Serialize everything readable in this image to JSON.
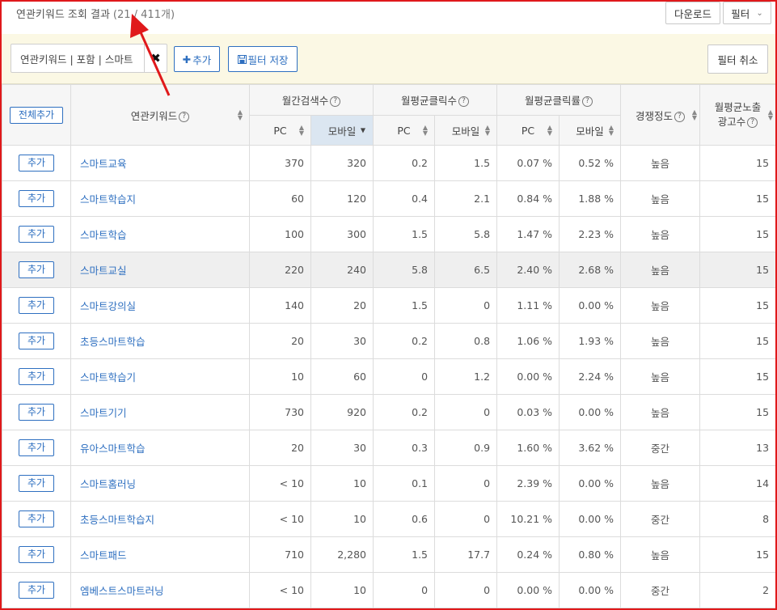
{
  "header": {
    "title": "연관키워드 조회 결과",
    "count": "(21 / 411개)",
    "download_label": "다운로드",
    "filter_label": "필터"
  },
  "filterbar": {
    "chip_label": "연관키워드 | 포함 | 스마트",
    "add_label": "추가",
    "save_label": "필터 저장",
    "cancel_label": "필터 취소"
  },
  "table": {
    "add_all_label": "전체추가",
    "headers": {
      "keyword": "연관키워드",
      "search": "월간검색수",
      "clicks": "월평균클릭수",
      "ctr": "월평균클릭률",
      "competition": "경쟁정도",
      "ads_line1": "월평균노출",
      "ads_line2": "광고수"
    },
    "sub": {
      "pc": "PC",
      "mobile": "모바일"
    },
    "row_add_label": "추가",
    "rows": [
      {
        "kw": "스마트교육",
        "pc": "370",
        "mo": "320",
        "cpc": "0.2",
        "cmo": "1.5",
        "rpc": "0.07 %",
        "rmo": "0.52 %",
        "comp": "높음",
        "ads": "15"
      },
      {
        "kw": "스마트학습지",
        "pc": "60",
        "mo": "120",
        "cpc": "0.4",
        "cmo": "2.1",
        "rpc": "0.84 %",
        "rmo": "1.88 %",
        "comp": "높음",
        "ads": "15"
      },
      {
        "kw": "스마트학습",
        "pc": "100",
        "mo": "300",
        "cpc": "1.5",
        "cmo": "5.8",
        "rpc": "1.47 %",
        "rmo": "2.23 %",
        "comp": "높음",
        "ads": "15"
      },
      {
        "kw": "스마트교실",
        "pc": "220",
        "mo": "240",
        "cpc": "5.8",
        "cmo": "6.5",
        "rpc": "2.40 %",
        "rmo": "2.68 %",
        "comp": "높음",
        "ads": "15"
      },
      {
        "kw": "스마트강의실",
        "pc": "140",
        "mo": "20",
        "cpc": "1.5",
        "cmo": "0",
        "rpc": "1.11 %",
        "rmo": "0.00 %",
        "comp": "높음",
        "ads": "15"
      },
      {
        "kw": "초등스마트학습",
        "pc": "20",
        "mo": "30",
        "cpc": "0.2",
        "cmo": "0.8",
        "rpc": "1.06 %",
        "rmo": "1.93 %",
        "comp": "높음",
        "ads": "15"
      },
      {
        "kw": "스마트학습기",
        "pc": "10",
        "mo": "60",
        "cpc": "0",
        "cmo": "1.2",
        "rpc": "0.00 %",
        "rmo": "2.24 %",
        "comp": "높음",
        "ads": "15"
      },
      {
        "kw": "스마트기기",
        "pc": "730",
        "mo": "920",
        "cpc": "0.2",
        "cmo": "0",
        "rpc": "0.03 %",
        "rmo": "0.00 %",
        "comp": "높음",
        "ads": "15"
      },
      {
        "kw": "유아스마트학습",
        "pc": "20",
        "mo": "30",
        "cpc": "0.3",
        "cmo": "0.9",
        "rpc": "1.60 %",
        "rmo": "3.62 %",
        "comp": "중간",
        "ads": "13"
      },
      {
        "kw": "스마트홈러닝",
        "pc": "< 10",
        "mo": "10",
        "cpc": "0.1",
        "cmo": "0",
        "rpc": "2.39 %",
        "rmo": "0.00 %",
        "comp": "높음",
        "ads": "14"
      },
      {
        "kw": "초등스마트학습지",
        "pc": "< 10",
        "mo": "10",
        "cpc": "0.6",
        "cmo": "0",
        "rpc": "10.21 %",
        "rmo": "0.00 %",
        "comp": "중간",
        "ads": "8"
      },
      {
        "kw": "스마트패드",
        "pc": "710",
        "mo": "2,280",
        "cpc": "1.5",
        "cmo": "17.7",
        "rpc": "0.24 %",
        "rmo": "0.80 %",
        "comp": "높음",
        "ads": "15"
      },
      {
        "kw": "엠베스트스마트러닝",
        "pc": "< 10",
        "mo": "10",
        "cpc": "0",
        "cmo": "0",
        "rpc": "0.00 %",
        "rmo": "0.00 %",
        "comp": "중간",
        "ads": "2"
      }
    ]
  },
  "colors": {
    "accent": "#2e6fc0",
    "annotation": "#e0191b",
    "filter_bg": "#fbf8e4",
    "active_sort": "#dbe6f1"
  }
}
